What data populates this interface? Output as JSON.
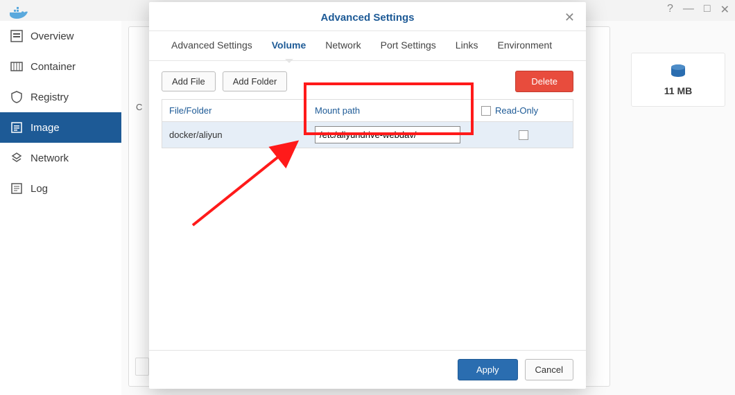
{
  "window_controls": {
    "help": "?",
    "min": "—",
    "max": "□",
    "close": "✕"
  },
  "sidebar": {
    "items": [
      {
        "label": "Overview",
        "name": "sidebar-item-overview",
        "icon": "overview"
      },
      {
        "label": "Container",
        "name": "sidebar-item-container",
        "icon": "container"
      },
      {
        "label": "Registry",
        "name": "sidebar-item-registry",
        "icon": "registry"
      },
      {
        "label": "Image",
        "name": "sidebar-item-image",
        "icon": "image",
        "active": true
      },
      {
        "label": "Network",
        "name": "sidebar-item-network",
        "icon": "network"
      },
      {
        "label": "Log",
        "name": "sidebar-item-log",
        "icon": "log"
      }
    ]
  },
  "info_card": {
    "size": "11 MB"
  },
  "modal": {
    "title": "Advanced Settings",
    "tabs": [
      {
        "label": "Advanced Settings",
        "name": "tab-advanced-settings"
      },
      {
        "label": "Volume",
        "name": "tab-volume",
        "active": true
      },
      {
        "label": "Network",
        "name": "tab-network"
      },
      {
        "label": "Port Settings",
        "name": "tab-port-settings"
      },
      {
        "label": "Links",
        "name": "tab-links"
      },
      {
        "label": "Environment",
        "name": "tab-environment"
      }
    ],
    "toolbar": {
      "add_file": "Add File",
      "add_folder": "Add Folder",
      "delete": "Delete"
    },
    "table": {
      "headers": {
        "file_folder": "File/Folder",
        "mount_path": "Mount path",
        "read_only": "Read-Only"
      },
      "rows": [
        {
          "file_folder": "docker/aliyun",
          "mount_path": "/etc/aliyundrive-webdav/",
          "read_only": false
        }
      ]
    },
    "footer": {
      "apply": "Apply",
      "cancel": "Cancel"
    }
  },
  "partial_letters": {
    "top": "C"
  }
}
